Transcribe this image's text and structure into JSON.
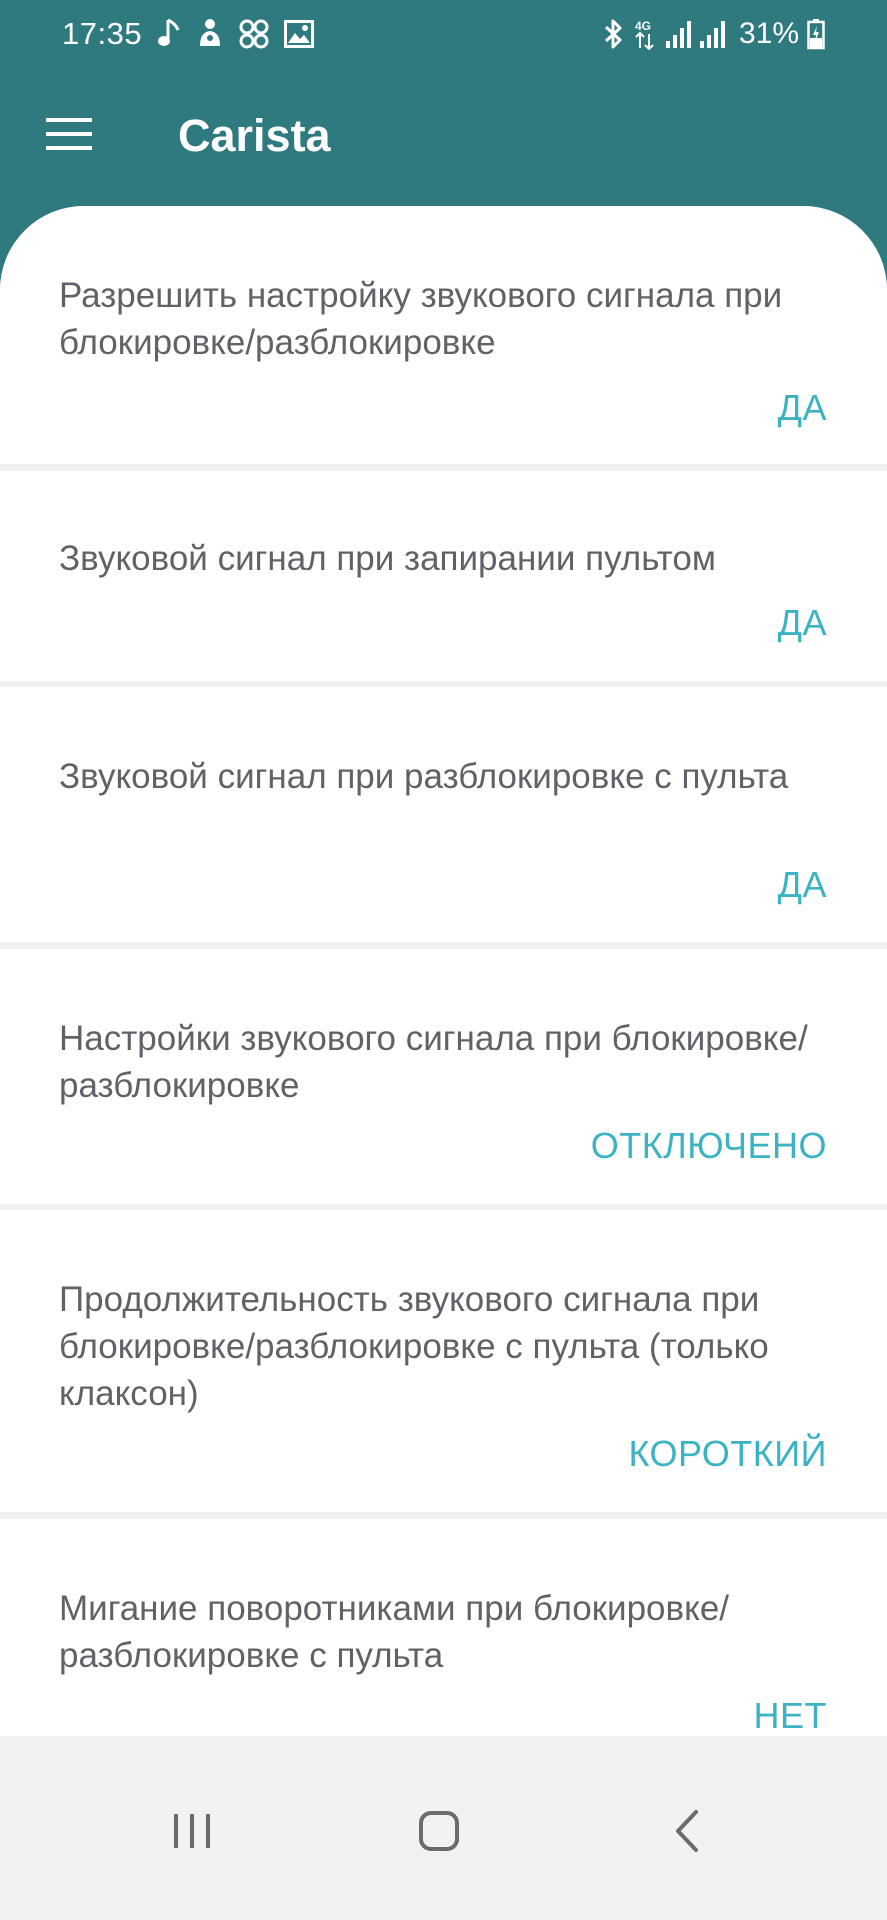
{
  "status_bar": {
    "time": "17:35",
    "battery_percent": "31%",
    "network": "4G",
    "icons_left": [
      "music-note-icon",
      "notification-icon",
      "pinwheel-icon",
      "image-icon"
    ],
    "icons_right": [
      "bluetooth-icon",
      "data-4g-icon",
      "signal-icon",
      "signal-icon",
      "battery-charging-icon"
    ]
  },
  "app_bar": {
    "title": "Carista",
    "menu_icon": "hamburger-menu-icon"
  },
  "settings": [
    {
      "title": "Разрешить настройку звукового сигнала при блокировке/разблокировке",
      "value": "ДА"
    },
    {
      "title": "Звуковой сигнал при запирании пультом",
      "value": "ДА"
    },
    {
      "title": "Звуковой сигнал при разблокировке с пульта",
      "value": "ДА"
    },
    {
      "title": "Настройки звукового сигнала при блокировке/разблокировке",
      "value": "ОТКЛЮЧЕНО"
    },
    {
      "title": "Продолжительность звукового сигнала при блокировке/разблокировке с пульта (только клаксон)",
      "value": "КОРОТКИЙ"
    },
    {
      "title": "Мигание поворотниками при блокировке/разблокировке с пульта",
      "value": "НЕТ"
    }
  ],
  "nav_bar": {
    "recents_icon": "recents-icon",
    "home_icon": "home-icon",
    "back_icon": "back-icon"
  },
  "colors": {
    "app_bar": "#2f7a7f",
    "accent_value": "#3bb3c3",
    "text": "#5f6368",
    "sheet_background": "#f1f1f2",
    "nav_bar": "#f2f2f3"
  }
}
